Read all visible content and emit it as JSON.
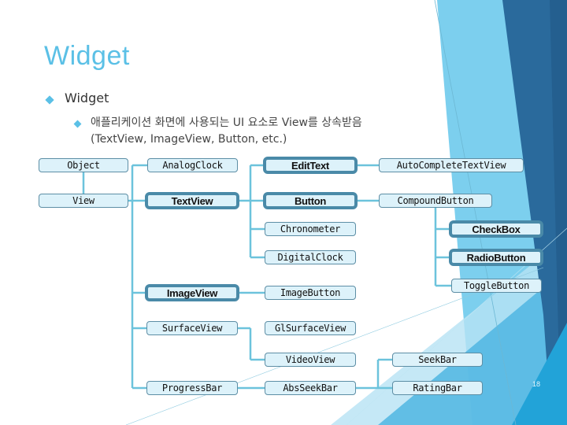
{
  "slide": {
    "title": "Widget",
    "bullet_1": "Widget",
    "bullet_2_line_1": "애플리케이션 화면에 사용되는 UI 요소로 View를 상속받음",
    "bullet_2_line_2": "(TextView, ImageView, Button, etc.)",
    "page_number": "18"
  },
  "colors": {
    "title": "#5bc0e6",
    "node_fill": "#ddf2fa",
    "node_border": "#5d8ea5",
    "highlight_border": "#4a8aa8",
    "connector": "#6cc3dc",
    "bg_dark_blue": "#2a6a9c",
    "bg_light_blue": "#7ccfee"
  },
  "hierarchy": {
    "nodes": [
      {
        "id": "object",
        "label": "Object",
        "highlight": false
      },
      {
        "id": "view",
        "label": "View",
        "highlight": false
      },
      {
        "id": "analogclock",
        "label": "AnalogClock",
        "highlight": false
      },
      {
        "id": "textview",
        "label": "TextView",
        "highlight": true
      },
      {
        "id": "edittext",
        "label": "EditText",
        "highlight": true
      },
      {
        "id": "button",
        "label": "Button",
        "highlight": true
      },
      {
        "id": "chronometer",
        "label": "Chronometer",
        "highlight": false
      },
      {
        "id": "digitalclock",
        "label": "DigitalClock",
        "highlight": false
      },
      {
        "id": "autocomplete",
        "label": "AutoCompleteTextView",
        "highlight": false
      },
      {
        "id": "compoundbutton",
        "label": "CompoundButton",
        "highlight": false
      },
      {
        "id": "checkbox",
        "label": "CheckBox",
        "highlight": true
      },
      {
        "id": "radiobutton",
        "label": "RadioButton",
        "highlight": true
      },
      {
        "id": "togglebutton",
        "label": "ToggleButton",
        "highlight": false
      },
      {
        "id": "imageview",
        "label": "ImageView",
        "highlight": true
      },
      {
        "id": "imagebutton",
        "label": "ImageButton",
        "highlight": false
      },
      {
        "id": "surfaceview",
        "label": "SurfaceView",
        "highlight": false
      },
      {
        "id": "glsurfaceview",
        "label": "GlSurfaceView",
        "highlight": false
      },
      {
        "id": "videoview",
        "label": "VideoView",
        "highlight": false
      },
      {
        "id": "seekbar",
        "label": "SeekBar",
        "highlight": false
      },
      {
        "id": "progressbar",
        "label": "ProgressBar",
        "highlight": false
      },
      {
        "id": "absseekbar",
        "label": "AbsSeekBar",
        "highlight": false
      },
      {
        "id": "ratingbar",
        "label": "RatingBar",
        "highlight": false
      }
    ],
    "edges": [
      [
        "object",
        "view"
      ],
      [
        "view",
        "analogclock"
      ],
      [
        "view",
        "textview"
      ],
      [
        "view",
        "imageview"
      ],
      [
        "view",
        "surfaceview"
      ],
      [
        "view",
        "progressbar"
      ],
      [
        "textview",
        "edittext"
      ],
      [
        "textview",
        "button"
      ],
      [
        "textview",
        "chronometer"
      ],
      [
        "textview",
        "digitalclock"
      ],
      [
        "edittext",
        "autocomplete"
      ],
      [
        "button",
        "compoundbutton"
      ],
      [
        "compoundbutton",
        "checkbox"
      ],
      [
        "compoundbutton",
        "radiobutton"
      ],
      [
        "compoundbutton",
        "togglebutton"
      ],
      [
        "imageview",
        "imagebutton"
      ],
      [
        "surfaceview",
        "glsurfaceview"
      ],
      [
        "surfaceview",
        "videoview"
      ],
      [
        "progressbar",
        "absseekbar"
      ],
      [
        "absseekbar",
        "seekbar"
      ],
      [
        "absseekbar",
        "ratingbar"
      ]
    ]
  }
}
